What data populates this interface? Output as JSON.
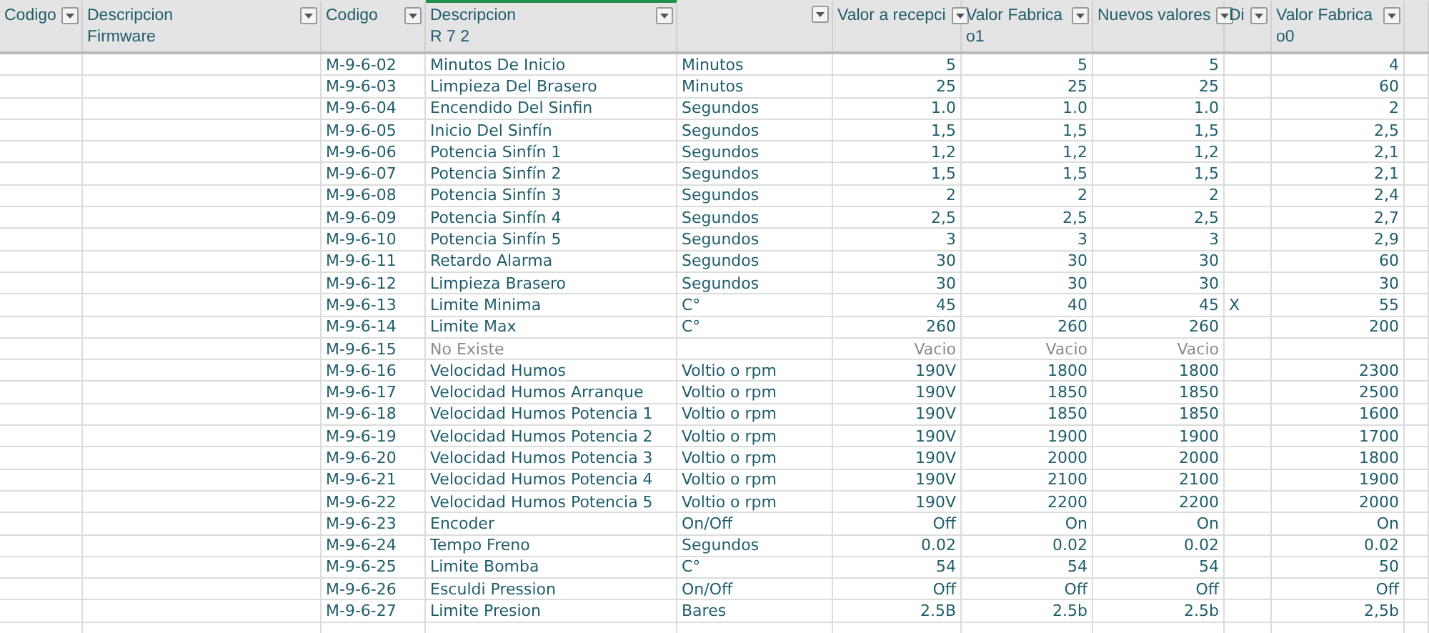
{
  "columns": [
    {
      "label": "Codigo",
      "selected": false
    },
    {
      "label": "Descripcion",
      "sublabel": "Firmware",
      "selected": false
    },
    {
      "label": "Codigo",
      "selected": false
    },
    {
      "label": "Descripcion",
      "sublabel": "R 7 2",
      "selected": true
    },
    {
      "selected": false
    },
    {
      "label": "Valor a recepci",
      "selected": false
    },
    {
      "label": "Valor Fabrica",
      "sublabel": "o1",
      "selected": false
    },
    {
      "label": "Nuevos valores",
      "selected": false
    },
    {
      "label": "Di",
      "selected": false
    },
    {
      "label": "Valor Fabrica",
      "sublabel": "o0",
      "selected": false
    }
  ],
  "rows": [
    {
      "code": "M-9-6-02",
      "description": "Minutos De Inicio",
      "unit": "Minutos",
      "reception": "5",
      "factory_o1": "5",
      "new_value": "5",
      "factory_o0": "4",
      "muted": false
    },
    {
      "code": "M-9-6-03",
      "description": "Limpieza Del Brasero",
      "unit": "Minutos",
      "reception": "25",
      "factory_o1": "25",
      "new_value": "25",
      "factory_o0": "60",
      "muted": false
    },
    {
      "code": "M-9-6-04",
      "description": "Encendido Del Sinfin",
      "unit": "Segundos",
      "reception": "1.0",
      "factory_o1": "1.0",
      "new_value": "1.0",
      "factory_o0": "2",
      "muted": false
    },
    {
      "code": "M-9-6-05",
      "description": "Inicio Del Sinfín",
      "unit": "Segundos",
      "reception": "1,5",
      "factory_o1": "1,5",
      "new_value": "1,5",
      "factory_o0": "2,5",
      "muted": false
    },
    {
      "code": "M-9-6-06",
      "description": "Potencia Sinfín 1",
      "unit": "Segundos",
      "reception": "1,2",
      "factory_o1": "1,2",
      "new_value": "1,2",
      "factory_o0": "2,1",
      "muted": false
    },
    {
      "code": "M-9-6-07",
      "description": "Potencia Sinfín 2",
      "unit": "Segundos",
      "reception": "1,5",
      "factory_o1": "1,5",
      "new_value": "1,5",
      "factory_o0": "2,1",
      "muted": false
    },
    {
      "code": "M-9-6-08",
      "description": "Potencia Sinfín 3",
      "unit": "Segundos",
      "reception": "2",
      "factory_o1": "2",
      "new_value": "2",
      "factory_o0": "2,4",
      "muted": false
    },
    {
      "code": "M-9-6-09",
      "description": "Potencia Sinfín 4",
      "unit": "Segundos",
      "reception": "2,5",
      "factory_o1": "2,5",
      "new_value": "2,5",
      "factory_o0": "2,7",
      "muted": false
    },
    {
      "code": "M-9-6-10",
      "description": "Potencia Sinfín 5",
      "unit": "Segundos",
      "reception": "3",
      "factory_o1": "3",
      "new_value": "3",
      "factory_o0": "2,9",
      "muted": false
    },
    {
      "code": "M-9-6-11",
      "description": "Retardo Alarma",
      "unit": "Segundos",
      "reception": "30",
      "factory_o1": "30",
      "new_value": "30",
      "factory_o0": "60",
      "muted": false
    },
    {
      "code": "M-9-6-12",
      "description": "Limpieza Brasero",
      "unit": "Segundos",
      "reception": "30",
      "factory_o1": "30",
      "new_value": "30",
      "factory_o0": "30",
      "muted": false
    },
    {
      "code": "M-9-6-13",
      "description": "Limite Minima",
      "unit": "C°",
      "reception": "45",
      "factory_o1": "40",
      "new_value": "45",
      "di": "X",
      "factory_o0": "55",
      "muted": false
    },
    {
      "code": "M-9-6-14",
      "description": "Limite Max",
      "unit": "C°",
      "reception": "260",
      "factory_o1": "260",
      "new_value": "260",
      "factory_o0": "200",
      "muted": false
    },
    {
      "code": "M-9-6-15",
      "description": "No Existe",
      "reception": "Vacio",
      "factory_o1": "Vacio",
      "new_value": "Vacio",
      "muted": true
    },
    {
      "code": "M-9-6-16",
      "description": "Velocidad Humos",
      "unit": "Voltio o rpm",
      "reception": "190V",
      "factory_o1": "1800",
      "new_value": "1800",
      "factory_o0": "2300",
      "muted": false
    },
    {
      "code": "M-9-6-17",
      "description": "Velocidad Humos Arranque",
      "unit": "Voltio o rpm",
      "reception": "190V",
      "factory_o1": "1850",
      "new_value": "1850",
      "factory_o0": "2500",
      "muted": false
    },
    {
      "code": "M-9-6-18",
      "description": "Velocidad Humos Potencia 1",
      "unit": "Voltio o rpm",
      "reception": "190V",
      "factory_o1": "1850",
      "new_value": "1850",
      "factory_o0": "1600",
      "muted": false
    },
    {
      "code": "M-9-6-19",
      "description": "Velocidad Humos Potencia 2",
      "unit": "Voltio o rpm",
      "reception": "190V",
      "factory_o1": "1900",
      "new_value": "1900",
      "factory_o0": "1700",
      "muted": false
    },
    {
      "code": "M-9-6-20",
      "description": "Velocidad Humos Potencia 3",
      "unit": "Voltio o rpm",
      "reception": "190V",
      "factory_o1": "2000",
      "new_value": "2000",
      "factory_o0": "1800",
      "muted": false
    },
    {
      "code": "M-9-6-21",
      "description": "Velocidad Humos Potencia 4",
      "unit": "Voltio o rpm",
      "reception": "190V",
      "factory_o1": "2100",
      "new_value": "2100",
      "factory_o0": "1900",
      "muted": false
    },
    {
      "code": "M-9-6-22",
      "description": "Velocidad Humos Potencia 5",
      "unit": "Voltio o rpm",
      "reception": "190V",
      "factory_o1": "2200",
      "new_value": "2200",
      "factory_o0": "2000",
      "muted": false
    },
    {
      "code": "M-9-6-23",
      "description": "Encoder",
      "unit": "On/Off",
      "reception": "Off",
      "factory_o1": "On",
      "new_value": "On",
      "factory_o0": "On",
      "muted": false
    },
    {
      "code": "M-9-6-24",
      "description": "Tempo Freno",
      "unit": "Segundos",
      "reception": "0.02",
      "factory_o1": "0.02",
      "new_value": "0.02",
      "factory_o0": "0.02",
      "muted": false
    },
    {
      "code": "M-9-6-25",
      "description": "Limite Bomba",
      "unit": "C°",
      "reception": "54",
      "factory_o1": "54",
      "new_value": "54",
      "factory_o0": "50",
      "muted": false
    },
    {
      "code": "M-9-6-26",
      "description": "Esculdi Pression",
      "unit": "On/Off",
      "reception": "Off",
      "factory_o1": "Off",
      "new_value": "Off",
      "factory_o0": "Off",
      "muted": false
    },
    {
      "code": "M-9-6-27",
      "description": "Limite Presion",
      "unit": "Bares",
      "reception": "2.5B",
      "factory_o1": "2.5b",
      "new_value": "2.5b",
      "factory_o0": "2,5b",
      "muted": false
    }
  ]
}
